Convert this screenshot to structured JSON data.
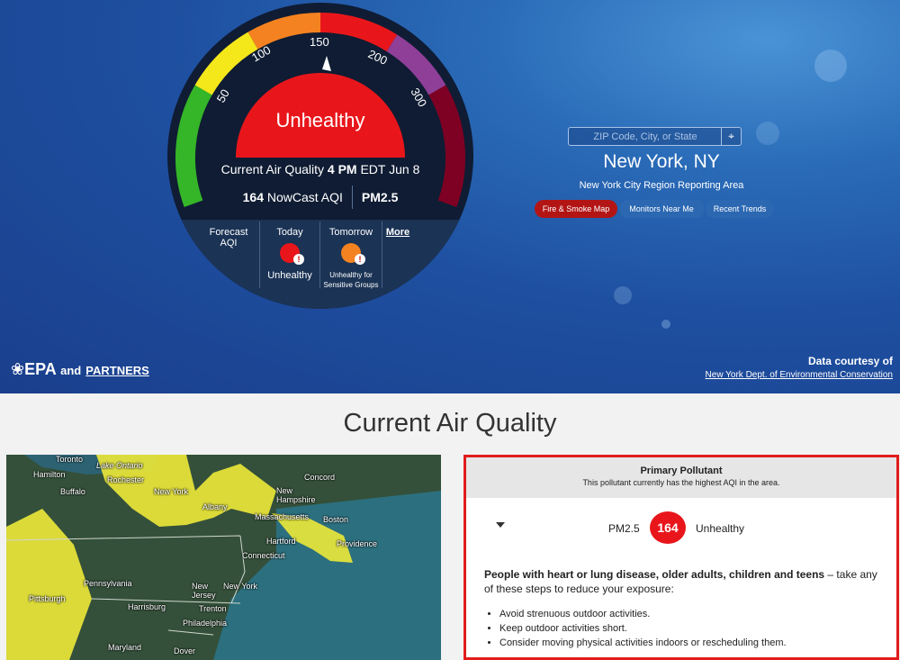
{
  "dial": {
    "category": "Unhealthy",
    "ticks": [
      "50",
      "100",
      "150",
      "200",
      "300"
    ],
    "aqi_value": 164,
    "colors": {
      "good": "#35b528",
      "moderate": "#f4e71a",
      "usg": "#f58220",
      "unhealthy": "#e8161b",
      "very_unhealthy": "#8f3f97",
      "hazardous": "#7e0023"
    }
  },
  "current": {
    "label": "Current Air Quality",
    "time": "4 PM",
    "date": "EDT Jun 8",
    "aqi": "164",
    "aqi_label": "NowCast AQI",
    "pollutant": "PM2.5"
  },
  "forecast": {
    "label": "Forecast AQI",
    "today_label": "Today",
    "today_category": "Unhealthy",
    "today_color": "#e8161b",
    "tomorrow_label": "Tomorrow",
    "tomorrow_category_line1": "Unhealthy for",
    "tomorrow_category_line2": "Sensitive Groups",
    "tomorrow_color": "#f58220",
    "more_link": "More"
  },
  "search": {
    "placeholder": "ZIP Code, City, or State",
    "locate_icon": "crosshair-icon"
  },
  "location": {
    "city": "New York, NY",
    "region": "New York City Region Reporting Area"
  },
  "buttons": {
    "fire_smoke": "Fire & Smoke Map",
    "monitors": "Monitors Near Me",
    "trends": "Recent Trends"
  },
  "branding": {
    "epa": "EPA",
    "and": "and",
    "partners": "PARTNERS"
  },
  "courtesy": {
    "title": "Data courtesy of",
    "source": "New York Dept. of Environmental Conservation"
  },
  "section_heading": "Current Air Quality",
  "map": {
    "labels": [
      "Toronto",
      "Hamilton",
      "Lake Ontario",
      "Rochester",
      "Buffalo",
      "New York",
      "Concord",
      "New Hampshire",
      "Albany",
      "Massachusetts",
      "Boston",
      "Providence",
      "Hartford",
      "Connecticut",
      "Pennsylvania",
      "Pittsburgh",
      "New Jersey",
      "New York",
      "Harrisburg",
      "Trenton",
      "Philadelphia",
      "Maryland",
      "Dover"
    ]
  },
  "pollutant_panel": {
    "title": "Primary Pollutant",
    "subtitle": "This pollutant currently has the highest AQI in the area.",
    "name": "PM2.5",
    "value": "164",
    "category": "Unhealthy",
    "advice_bold": "People with heart or lung disease, older adults, children and teens",
    "advice_rest": " – take any of these steps to reduce your exposure:",
    "steps": [
      "Avoid strenuous outdoor activities.",
      "Keep outdoor activities short.",
      "Consider moving physical activities indoors or rescheduling them."
    ]
  }
}
